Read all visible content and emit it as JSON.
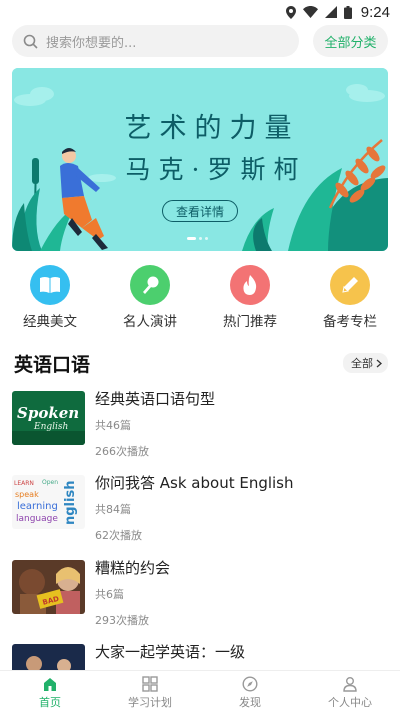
{
  "status_bar": {
    "time": "9:24"
  },
  "search": {
    "placeholder": "搜索你想要的...",
    "all_categories_label": "全部分类"
  },
  "banner": {
    "line1": "艺术的力量",
    "line2": "马克·罗斯柯",
    "button_label": "查看详情"
  },
  "categories": [
    {
      "label": "经典美文",
      "icon": "book-icon",
      "color": "#35bff0"
    },
    {
      "label": "名人演讲",
      "icon": "microphone-icon",
      "color": "#4ccf6e"
    },
    {
      "label": "热门推荐",
      "icon": "flame-icon",
      "color": "#f37374"
    },
    {
      "label": "备考专栏",
      "icon": "pencil-icon",
      "color": "#f6c34c"
    }
  ],
  "section": {
    "title": "英语口语",
    "all_label": "全部"
  },
  "items": [
    {
      "title": "经典英语口语句型",
      "count": "共46篇",
      "plays": "266次播放"
    },
    {
      "title": "你问我答 Ask about English",
      "count": "共84篇",
      "plays": "62次播放"
    },
    {
      "title": "糟糕的约会",
      "count": "共6篇",
      "plays": "293次播放"
    },
    {
      "title": "大家一起学英语：一级",
      "count": "",
      "plays": ""
    }
  ],
  "tabs": [
    {
      "label": "首页",
      "icon": "home-icon",
      "active": true
    },
    {
      "label": "学习计划",
      "icon": "grid-icon",
      "active": false
    },
    {
      "label": "发现",
      "icon": "compass-icon",
      "active": false
    },
    {
      "label": "个人中心",
      "icon": "person-icon",
      "active": false
    }
  ],
  "colors": {
    "accent": "#21b16a",
    "banner_bg": "#89e7e3"
  }
}
